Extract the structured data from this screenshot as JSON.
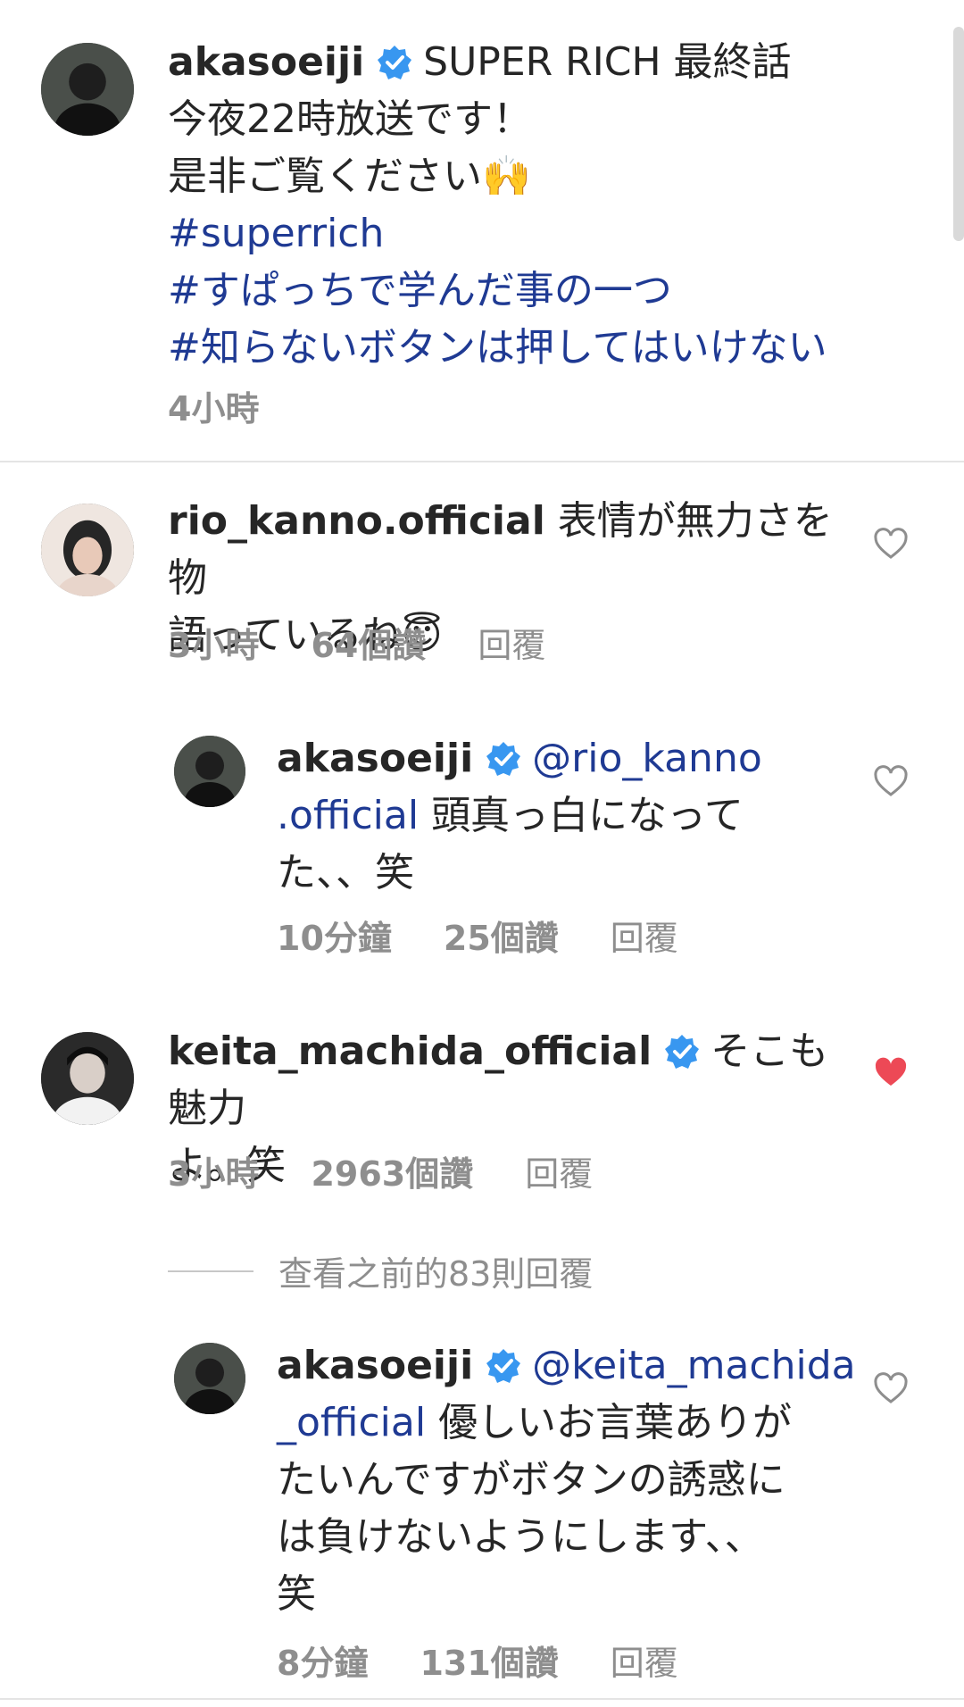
{
  "caption": {
    "username": "akasoeiji",
    "line1": "SUPER RICH  最終話",
    "line2": "今夜22時放送です！",
    "line3": "是非ご覧ください🙌",
    "hashtags": [
      "#superrich",
      "#すぱっちで学んだ事の一つ",
      "#知らないボタンは押してはいけない"
    ],
    "time": "4小時"
  },
  "comments": [
    {
      "username": "rio_kanno.official",
      "text1": "表情が無力さを物",
      "text2": "語っているね😇",
      "time": "3小時",
      "likes": "64個讚",
      "reply": "回覆"
    },
    {
      "username": "akasoeiji",
      "mention1": "@rio_kanno",
      "mention2": ".official",
      "text1": "頭真っ白になって",
      "text2": "た、、笑",
      "time": "10分鐘",
      "likes": "25個讚",
      "reply": "回覆"
    },
    {
      "username": "keita_machida_official",
      "text1": "そこも魅力",
      "text2": "よ。笑",
      "time": "3小時",
      "likes": "2963個讚",
      "reply": "回覆"
    },
    {
      "username": "akasoeiji",
      "mention1": "@keita_machida",
      "mention2": "_official",
      "text1": "優しいお言葉ありが",
      "text2": "たいんですがボタンの誘惑に",
      "text3": "は負けないようにします、、",
      "text4": "笑",
      "time": "8分鐘",
      "likes": "131個讚",
      "reply": "回覆"
    }
  ],
  "view_previous": "查看之前的83則回覆",
  "colors": {
    "verified": "#3897f0",
    "liked": "#ed4956",
    "link": "#1f3a93",
    "meta": "#8e8e8e"
  }
}
